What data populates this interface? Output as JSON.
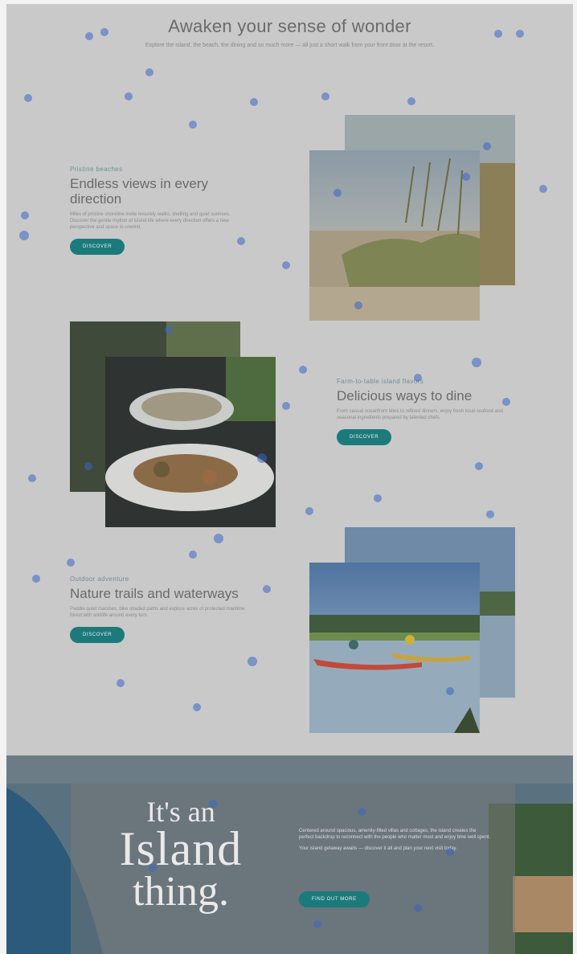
{
  "hero": {
    "title": "Awaken your sense of wonder",
    "subtitle": "Explore the island, the beach, the dining and so much more — all just a short walk from your front door at the resort."
  },
  "sections": [
    {
      "eyebrow": "Pristine beaches",
      "heading": "Endless views in every direction",
      "text": "Miles of pristine shoreline invite leisurely walks, shelling and quiet sunrises. Discover the gentle rhythm of island life where every direction offers a new perspective and space to unwind.",
      "button": "DISCOVER"
    },
    {
      "eyebrow": "Farm-to-table island flavors",
      "heading": "Delicious ways to dine",
      "text": "From casual oceanfront bites to refined dinners, enjoy fresh local seafood and seasonal ingredients prepared by talented chefs.",
      "button": "DISCOVER"
    },
    {
      "eyebrow": "Outdoor adventure",
      "heading": "Nature trails and waterways",
      "text": "Paddle quiet marshes, bike shaded paths and explore acres of protected maritime forest with wildlife around every turn.",
      "button": "DISCOVER"
    }
  ],
  "island": {
    "line1": "It's an",
    "line2": "Island",
    "line3": "thing.",
    "text1": "Centered around spacious, amenity-filled villas and cottages, the island creates the perfect backdrop to reconnect with the people who matter most and enjoy time well spent.",
    "text2": "Your island getaway awaits — discover it all and plan your next visit today.",
    "button": "FIND OUT MORE"
  },
  "colors": {
    "accent": "#1c7a7a",
    "overlay": "#c9c9c9",
    "dot": "#3a66c4"
  }
}
